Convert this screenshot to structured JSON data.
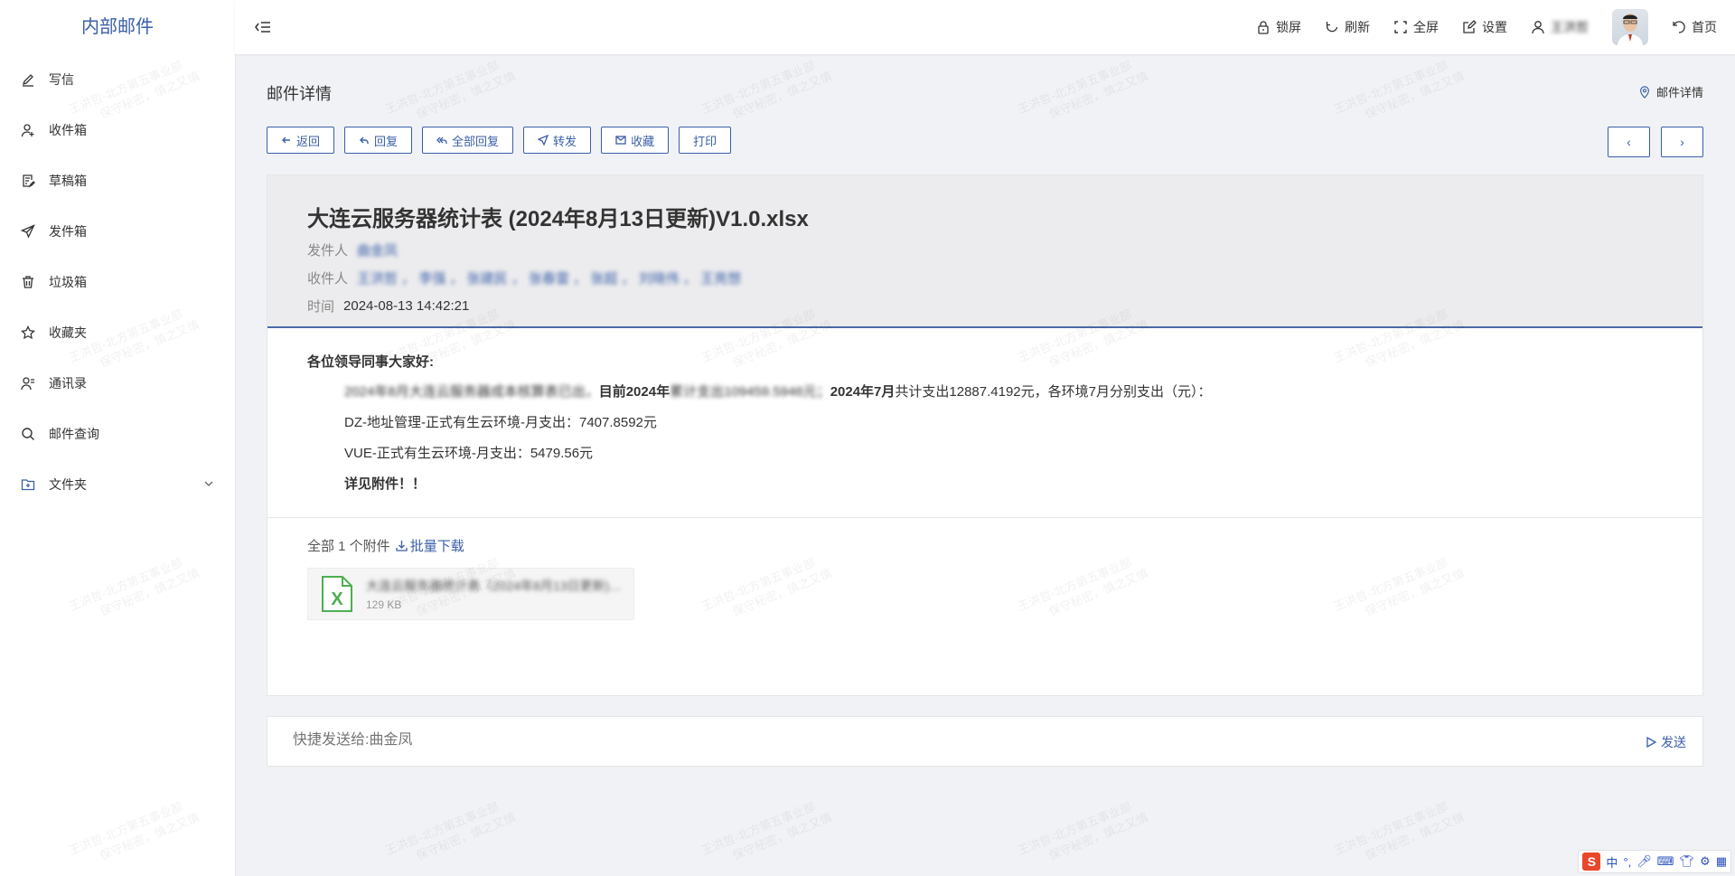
{
  "app": {
    "title": "内部邮件"
  },
  "sidebar": {
    "items": [
      {
        "label": "写信",
        "icon": "pen-icon"
      },
      {
        "label": "收件箱",
        "icon": "user-plus-icon"
      },
      {
        "label": "草稿箱",
        "icon": "draft-icon"
      },
      {
        "label": "发件箱",
        "icon": "send-icon"
      },
      {
        "label": "垃圾箱",
        "icon": "trash-icon"
      },
      {
        "label": "收藏夹",
        "icon": "star-icon"
      },
      {
        "label": "通讯录",
        "icon": "contacts-icon"
      },
      {
        "label": "邮件查询",
        "icon": "search-icon"
      },
      {
        "label": "文件夹",
        "icon": "folder-icon"
      }
    ]
  },
  "topbar": {
    "lock": "锁屏",
    "refresh": "刷新",
    "fullscreen": "全屏",
    "settings": "设置",
    "username": "王洪哲",
    "home": "首页"
  },
  "page": {
    "title": "邮件详情",
    "breadcrumb": "邮件详情"
  },
  "toolbar": {
    "back": "返回",
    "reply": "回复",
    "reply_all": "全部回复",
    "forward": "转发",
    "favorite": "收藏",
    "print": "打印",
    "prev": "‹",
    "next": "›"
  },
  "email": {
    "subject": "大连云服务器统计表 (2024年8月13日更新)V1.0.xlsx",
    "sender_label": "发件人",
    "sender": "曲金凤",
    "recipients_label": "收件人",
    "recipients": "王洪哲 ， 李强 ， 张建民 ， 张春雷 ， 张超 ， 刘晓伟 ， 王亮想",
    "time_label": "时间",
    "time": "2024-08-13 14:42:21",
    "greeting": "各位领导同事大家好:",
    "p1_a": "2024年8月大连云服务器成本核算表已出，",
    "p1_b": "目前2024年",
    "p1_c": "累计支出109459.5946元；",
    "p1_d": "2024年7月",
    "p1_e": "共计支出12887.4192元，各环境7月分别支出（元）：",
    "p2": "DZ-地址管理-正式有生云环境-月支出：7407.8592元",
    "p3": "VUE-正式有生云环境-月支出：5479.56元",
    "p4": "详见附件！！"
  },
  "attachments": {
    "summary": "全部 1 个附件",
    "batch_download": "批量下载",
    "files": [
      {
        "name": "大连云服务器统计表（2024年8月13日更新)V1.0.xlsx",
        "size": "129 KB"
      }
    ]
  },
  "quick_send": {
    "placeholder": "快捷发送给:曲金凤",
    "send": "发送"
  },
  "ime": {
    "lang": "中"
  },
  "watermark": {
    "line1": "王洪哲-北方第五事业部",
    "line2": "保守秘密，慎之又慎"
  },
  "colors": {
    "accent": "#3a5fa8",
    "header_bg": "#ececee",
    "page_bg": "#f0f2f5",
    "excel": "#4caf50"
  }
}
